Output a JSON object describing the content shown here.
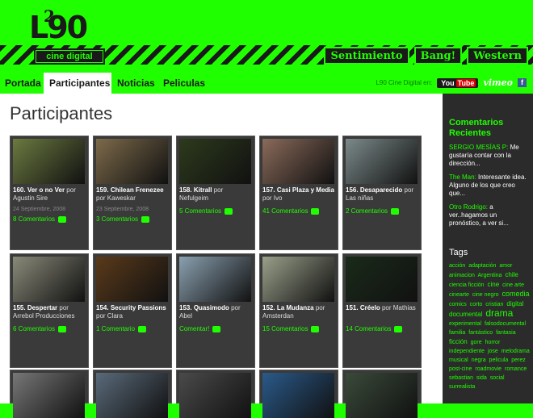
{
  "logo": {
    "main": "L90",
    "sup": "2",
    "sub": "cine digital"
  },
  "header_tabs": [
    "Sentimiento",
    "Bang!",
    "Western"
  ],
  "nav": {
    "items": [
      "Portada",
      "Participantes",
      "Noticias",
      "Peliculas"
    ],
    "active": "Participantes",
    "social_label": "L90 Cine Digital en:",
    "youtube": "You",
    "youtube2": "Tube",
    "vimeo": "vimeo",
    "facebook": "f"
  },
  "page_title": "Participantes",
  "cards": [
    {
      "num": "160.",
      "title": "Ver o no Ver",
      "by": "por",
      "author": "Agustin Sire",
      "date": "24 Septiembre, 2008",
      "comments": "8 Comentarios",
      "thumb": "#6b7a40"
    },
    {
      "num": "159.",
      "title": "Chilean Frenezee",
      "by": "por",
      "author": "Kaweskar",
      "date": "23 Septiembre, 2008",
      "comments": "3 Comentarios",
      "thumb": "#7d6a4a"
    },
    {
      "num": "158.",
      "title": "Kitrall",
      "by": "por",
      "author": "Nefulgeim",
      "date": "",
      "comments": "5 Comentarios",
      "thumb": "#2d3a1c"
    },
    {
      "num": "157.",
      "title": "Casi Plaza y Media",
      "by": "por",
      "author": "Ivo",
      "date": "",
      "comments": "41 Comentarios",
      "thumb": "#8a6a5a"
    },
    {
      "num": "156.",
      "title": "Desaparecido",
      "by": "por",
      "author": "Las niñas",
      "date": "",
      "comments": "2 Comentarios",
      "thumb": "#7c8a8a"
    },
    {
      "num": "155.",
      "title": "Despertar",
      "by": "por",
      "author": "Arrebol Producciones",
      "date": "",
      "comments": "6 Comentarios",
      "thumb": "#8a8a7a"
    },
    {
      "num": "154.",
      "title": "Security Passions",
      "by": "por",
      "author": "Clara",
      "date": "",
      "comments": "1 Comentario",
      "thumb": "#5a3a1a"
    },
    {
      "num": "153.",
      "title": "Quasimodo",
      "by": "por",
      "author": "Abel",
      "date": "",
      "comments": "Comentar!",
      "thumb": "#8aa0b0"
    },
    {
      "num": "152.",
      "title": "La Mudanza",
      "by": "por",
      "author": "Amsterdan",
      "date": "",
      "comments": "15 Comentarios",
      "thumb": "#9aa08a"
    },
    {
      "num": "151.",
      "title": "Créelo",
      "by": "por",
      "author": "Mathias",
      "date": "",
      "comments": "14 Comentarios",
      "thumb": "#1a2a1a"
    },
    {
      "thumb": "#777"
    },
    {
      "thumb": "#5a6a7a"
    },
    {
      "thumb": "#4a4a4a"
    },
    {
      "thumb": "#2a5a8a"
    },
    {
      "thumb": "#3a4a3a"
    }
  ],
  "sidebar": {
    "recent_title": "Comentarios Recientes",
    "comments": [
      {
        "who": "SERGIO MESÍAS P:",
        "text": "Me gustaría contar con la dirección..."
      },
      {
        "who": "The Man:",
        "text": "Interesante idea. Alguno de los que creo que..."
      },
      {
        "who": "Otro Rodrigo:",
        "text": "a ver..hagamos un pronóstico, a ver si..."
      }
    ],
    "tags_title": "Tags",
    "tags": [
      {
        "t": "acción",
        "s": 7
      },
      {
        "t": "adaptación",
        "s": 7
      },
      {
        "t": "amor",
        "s": 7
      },
      {
        "t": "animacion",
        "s": 7
      },
      {
        "t": "Argentina",
        "s": 7
      },
      {
        "t": "chile",
        "s": 8
      },
      {
        "t": "ciencia ficción",
        "s": 7
      },
      {
        "t": "cine",
        "s": 8
      },
      {
        "t": "cine arte",
        "s": 7
      },
      {
        "t": "cinearte",
        "s": 7
      },
      {
        "t": "cine negro",
        "s": 7
      },
      {
        "t": "comedia",
        "s": 9
      },
      {
        "t": "comics",
        "s": 7
      },
      {
        "t": "corto",
        "s": 7
      },
      {
        "t": "cristian",
        "s": 7
      },
      {
        "t": "digital",
        "s": 8
      },
      {
        "t": "documental",
        "s": 8
      },
      {
        "t": "drama",
        "s": 12
      },
      {
        "t": "experimental",
        "s": 7
      },
      {
        "t": "falsodocumental",
        "s": 7
      },
      {
        "t": "familia",
        "s": 7
      },
      {
        "t": "fantástico",
        "s": 7
      },
      {
        "t": "fantasia",
        "s": 7
      },
      {
        "t": "ficción",
        "s": 8
      },
      {
        "t": "gore",
        "s": 7
      },
      {
        "t": "horror",
        "s": 7
      },
      {
        "t": "independiente",
        "s": 7
      },
      {
        "t": "jose",
        "s": 7
      },
      {
        "t": "melodrama",
        "s": 7
      },
      {
        "t": "musical",
        "s": 7
      },
      {
        "t": "negra",
        "s": 7
      },
      {
        "t": "pelicula",
        "s": 7
      },
      {
        "t": "perez",
        "s": 7
      },
      {
        "t": "post-cine",
        "s": 7
      },
      {
        "t": "roadmovie",
        "s": 7
      },
      {
        "t": "romance",
        "s": 7
      },
      {
        "t": "sebastian",
        "s": 7
      },
      {
        "t": "sida",
        "s": 7
      },
      {
        "t": "social",
        "s": 7
      },
      {
        "t": "surrealista",
        "s": 7
      }
    ]
  }
}
